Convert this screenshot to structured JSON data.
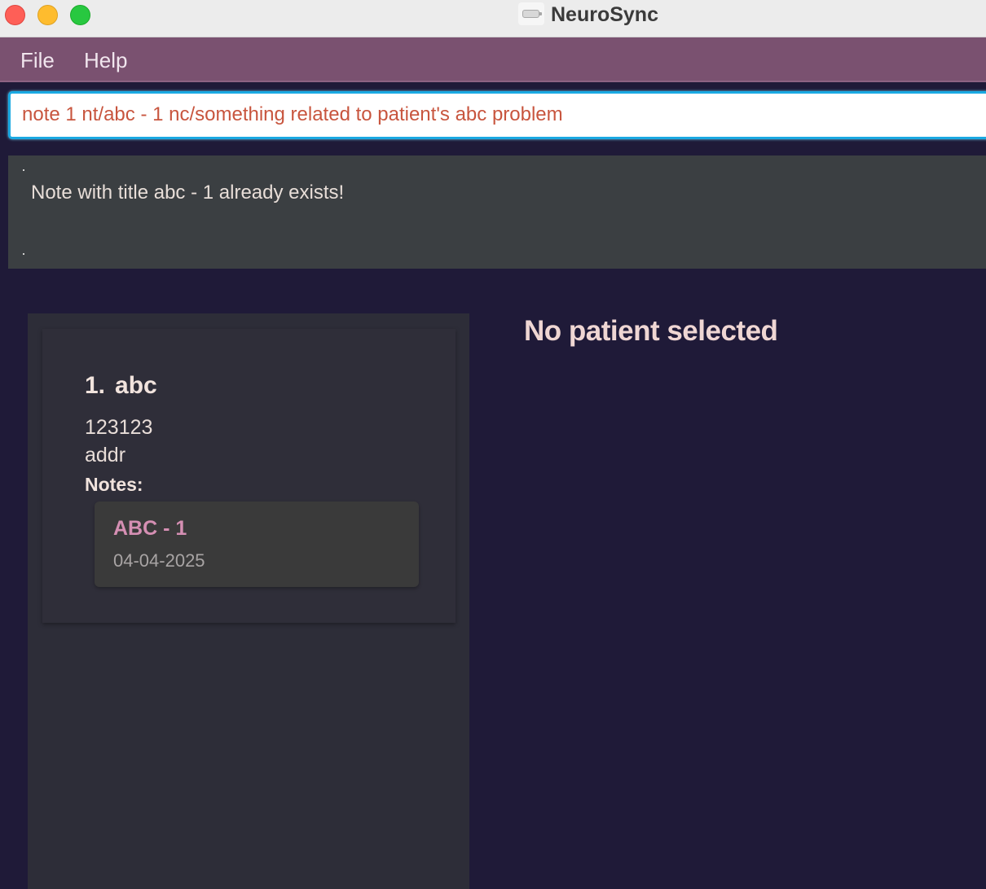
{
  "window": {
    "title": "NeuroSync"
  },
  "menu": {
    "file_label": "File",
    "help_label": "Help"
  },
  "command": {
    "value": "note 1 nt/abc - 1 nc/something related to patient's abc problem"
  },
  "result": {
    "message": "Note with title abc - 1 already exists!"
  },
  "patients": [
    {
      "index": "1.",
      "name": "abc",
      "phone": "123123",
      "address": "addr",
      "notes_label": "Notes:",
      "notes": [
        {
          "title": "ABC - 1",
          "date": "04-04-2025"
        }
      ]
    }
  ],
  "detail": {
    "placeholder": "No patient selected"
  },
  "colors": {
    "background": "#1f1a38",
    "menubar": "#7a5170",
    "command_text": "#c8553e",
    "command_border": "#1ba9e2",
    "note_title": "#d58fb3"
  },
  "icons": {
    "app": "app-icon",
    "close": "close-icon",
    "minimize": "minimize-icon",
    "maximize": "maximize-icon"
  }
}
